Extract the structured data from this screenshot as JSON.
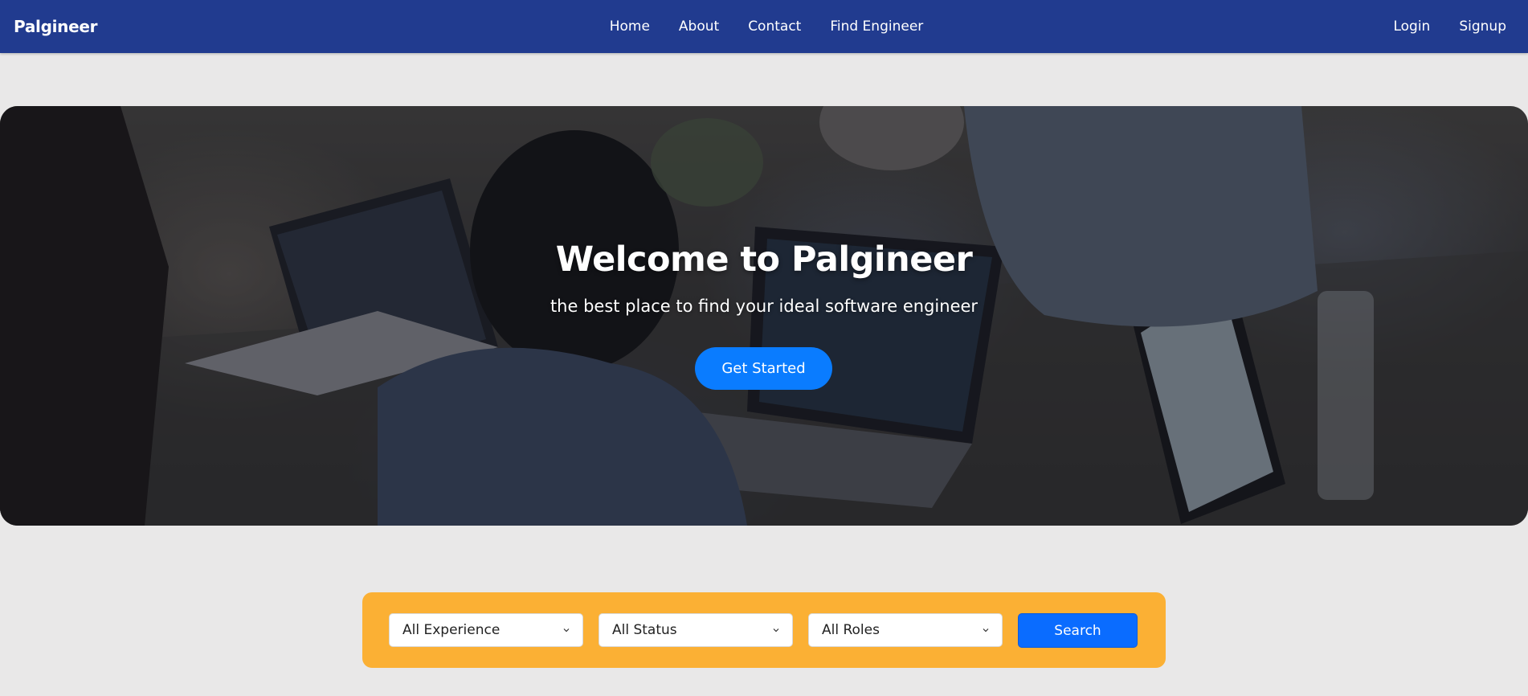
{
  "navbar": {
    "brand": "Palgineer",
    "links": [
      "Home",
      "About",
      "Contact",
      "Find Engineer"
    ],
    "auth": {
      "login": "Login",
      "signup": "Signup"
    },
    "background_color": "#213b8f"
  },
  "hero": {
    "title": "Welcome to Palgineer",
    "subtitle": "the best place to find your ideal software engineer",
    "cta_label": "Get Started",
    "cta_color": "#0a7cff"
  },
  "filters": {
    "background_color": "#fbb034",
    "experience": {
      "selected": "All Experience",
      "icon": "chevron-down-icon"
    },
    "status": {
      "selected": "All Status",
      "icon": "chevron-down-icon"
    },
    "roles": {
      "selected": "All Roles",
      "icon": "chevron-down-icon"
    },
    "search_label": "Search",
    "search_color": "#0a6cff"
  }
}
